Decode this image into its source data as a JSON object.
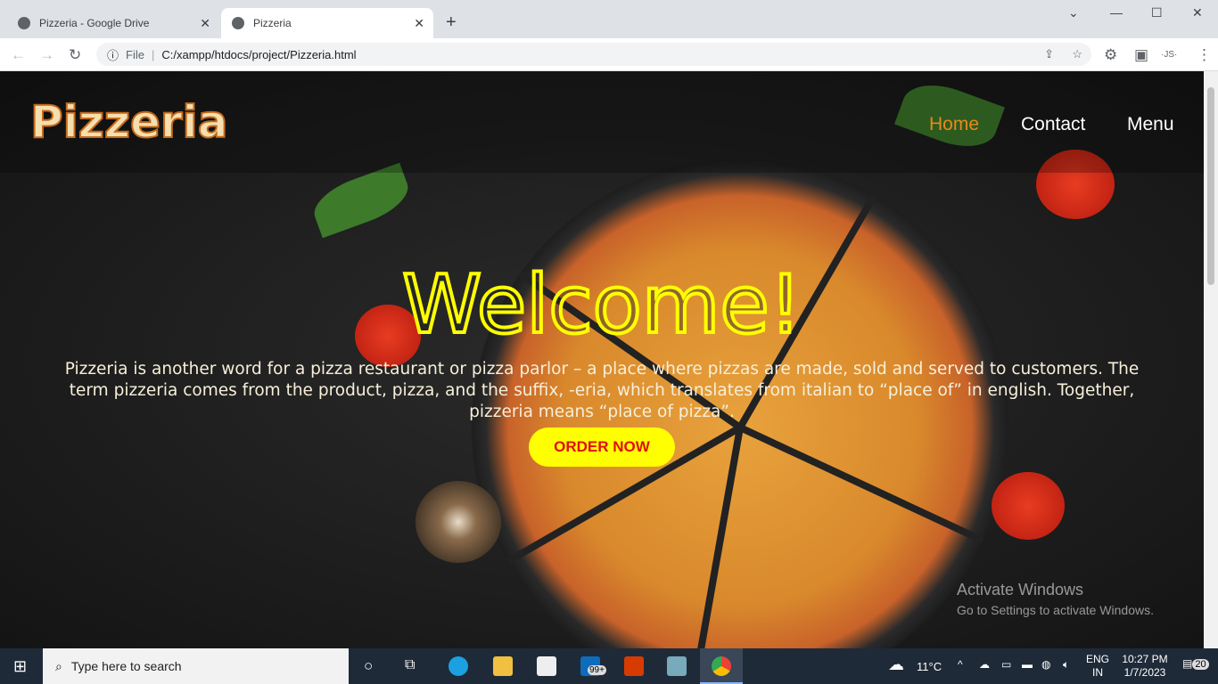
{
  "browser": {
    "tabs": [
      {
        "title": "Pizzeria - Google Drive",
        "active": false
      },
      {
        "title": "Pizzeria",
        "active": true
      }
    ],
    "url_scheme": "File",
    "url": "C:/xampp/htdocs/project/Pizzeria.html"
  },
  "site": {
    "logo": "Pizzeria",
    "nav": [
      {
        "label": "Home",
        "active": true
      },
      {
        "label": "Contact"
      },
      {
        "label": "Menu"
      }
    ],
    "heading": "Welcome!",
    "description": "Pizzeria is another word for a pizza restaurant or pizza parlor – a place where pizzas are made, sold and served to customers. The term pizzeria comes from the product, pizza, and the suffix, -eria, which translates from italian to “place of” in english. Together, pizzeria means “place of pizza”.",
    "cta": "ORDER NOW",
    "accent": "#ffff00",
    "nav_active_color": "#e8891a"
  },
  "watermark": {
    "title": "Activate Windows",
    "subtitle": "Go to Settings to activate Windows."
  },
  "taskbar": {
    "search_placeholder": "Type here to search",
    "store_badge": "99+",
    "weather": "11°C",
    "lang": "ENG",
    "region": "IN",
    "time": "10:27 PM",
    "date": "1/7/2023",
    "notifications": "20"
  }
}
